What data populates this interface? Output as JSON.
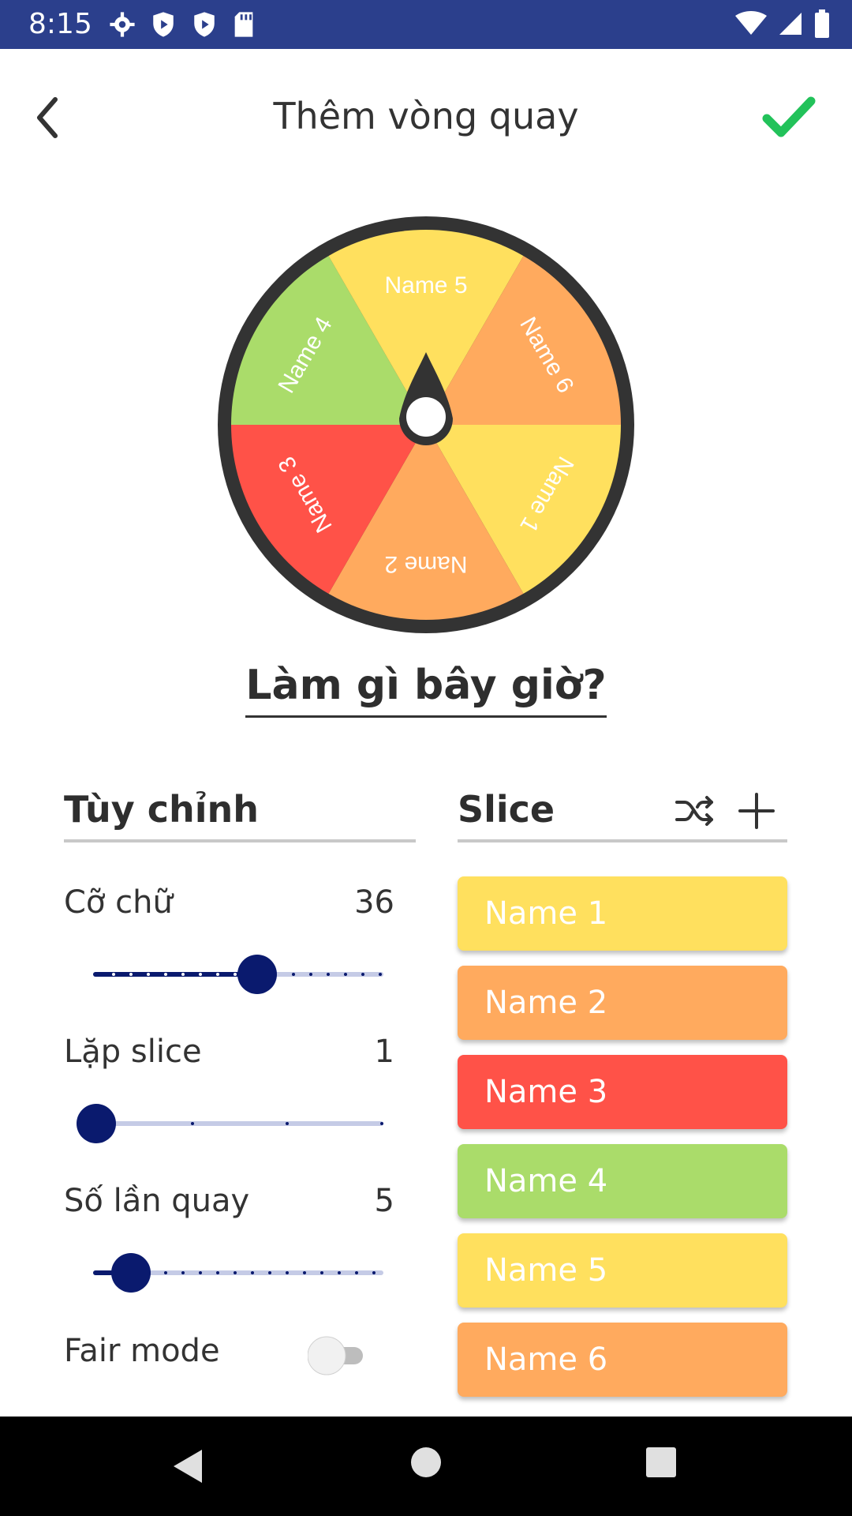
{
  "status": {
    "time": "8:15"
  },
  "header": {
    "title": "Thêm vòng quay"
  },
  "wheel": {
    "slices": [
      {
        "label": "Name 1",
        "color": "#ffe05e"
      },
      {
        "label": "Name 2",
        "color": "#ffaa5e"
      },
      {
        "label": "Name 3",
        "color": "#ff5248"
      },
      {
        "label": "Name 4",
        "color": "#aadc6a"
      },
      {
        "label": "Name 5",
        "color": "#ffe05e"
      },
      {
        "label": "Name 6",
        "color": "#ffaa5e"
      }
    ],
    "rim_color": "#333333"
  },
  "question": "Làm gì bây giờ?",
  "customize": {
    "title": "Tùy chỉnh",
    "font_size": {
      "label": "Cỡ chữ",
      "value": "36",
      "level": 0.5
    },
    "repeat_slice": {
      "label": "Lặp slice",
      "value": "1",
      "level": 0.0
    },
    "spin_count": {
      "label": "Số lần quay",
      "value": "5",
      "level": 0.12
    },
    "fair_mode": {
      "label": "Fair mode",
      "on": false
    }
  },
  "slice_panel": {
    "title": "Slice",
    "shuffle_icon": "shuffle-icon",
    "add_icon": "plus-icon",
    "items": [
      {
        "label": "Name 1",
        "color": "#ffe05e"
      },
      {
        "label": "Name 2",
        "color": "#ffaa5e"
      },
      {
        "label": "Name 3",
        "color": "#ff5248"
      },
      {
        "label": "Name 4",
        "color": "#aadc6a"
      },
      {
        "label": "Name 5",
        "color": "#ffe05e"
      },
      {
        "label": "Name 6",
        "color": "#ffaa5e"
      }
    ]
  },
  "colors": {
    "accent": "#0a1a6e",
    "check": "#22c25a",
    "status_bar": "#2b3f8c"
  }
}
